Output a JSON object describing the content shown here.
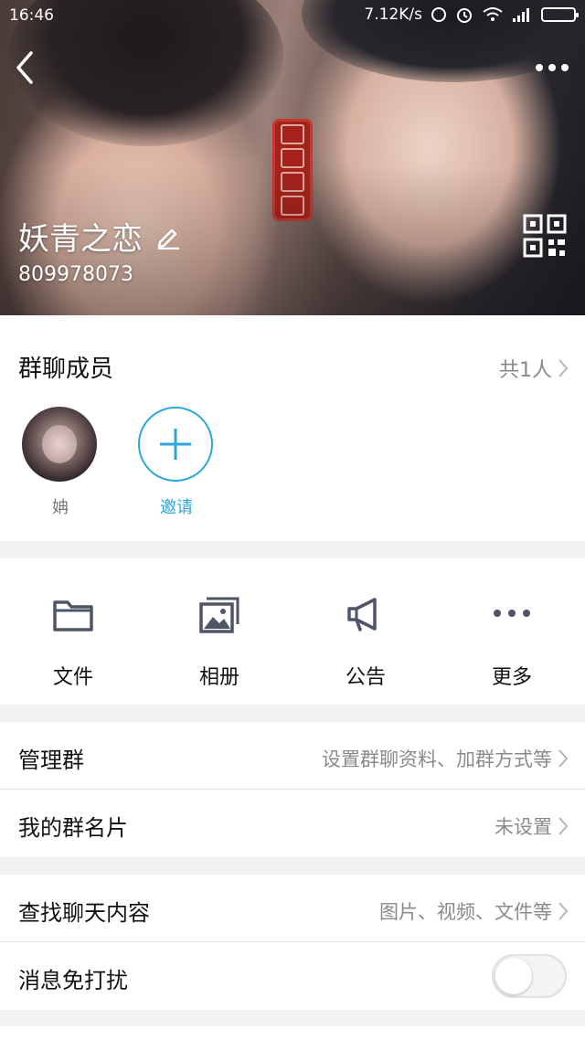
{
  "status_bar": {
    "time": "16:46",
    "speed": "7.12K/s"
  },
  "header": {
    "group_name": "妖青之恋",
    "group_id": "809978073"
  },
  "members_section": {
    "title": "群聊成员",
    "count_label": "共1人",
    "members": [
      {
        "name": "姌"
      }
    ],
    "invite_label": "邀请"
  },
  "actions": [
    {
      "label": "文件",
      "icon": "folder-icon"
    },
    {
      "label": "相册",
      "icon": "photo-album-icon"
    },
    {
      "label": "公告",
      "icon": "megaphone-icon"
    },
    {
      "label": "更多",
      "icon": "more-icon"
    }
  ],
  "rows": {
    "manage": {
      "title": "管理群",
      "value": "设置群聊资料、加群方式等"
    },
    "card": {
      "title": "我的群名片",
      "value": "未设置"
    },
    "search": {
      "title": "查找聊天内容",
      "value": "图片、视频、文件等"
    },
    "mute": {
      "title": "消息免打扰",
      "toggle_on": false
    }
  },
  "colors": {
    "accent": "#2aa6de",
    "icon_gray": "#4e5566"
  }
}
